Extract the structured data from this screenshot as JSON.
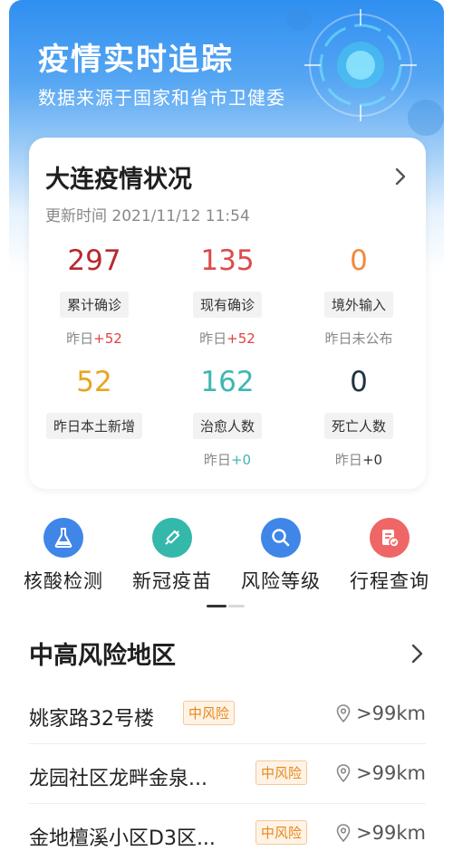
{
  "header": {
    "title": "疫情实时追踪",
    "subtitle": "数据来源于国家和省市卫健委"
  },
  "summary": {
    "title": "大连疫情状况",
    "update_label": "更新时间",
    "update_time": "2021/11/12 11:54",
    "stats": [
      {
        "value": "297",
        "label": "累计确诊",
        "delta_prefix": "昨日",
        "delta": "+52",
        "value_color": "#b8292d"
      },
      {
        "value": "135",
        "label": "现有确诊",
        "delta_prefix": "昨日",
        "delta": "+52",
        "value_color": "#de4a4a"
      },
      {
        "value": "0",
        "label": "境外输入",
        "delta_prefix": "昨日未公布",
        "delta": "",
        "value_color": "#f08a3c"
      },
      {
        "value": "52",
        "label": "昨日本土新增",
        "delta_prefix": "",
        "delta": "",
        "value_color": "#e8a51e"
      },
      {
        "value": "162",
        "label": "治愈人数",
        "delta_prefix": "昨日",
        "delta": "+0",
        "value_color": "#3eb7b1"
      },
      {
        "value": "0",
        "label": "死亡人数",
        "delta_prefix": "昨日",
        "delta": "+0",
        "value_color": "#1f3340"
      }
    ]
  },
  "quick_actions": [
    {
      "label": "核酸检测",
      "icon": "flask-icon",
      "color": "#3f86e8"
    },
    {
      "label": "新冠疫苗",
      "icon": "syringe-icon",
      "color": "#34b8aa"
    },
    {
      "label": "风险等级",
      "icon": "search-icon",
      "color": "#3f86e8"
    },
    {
      "label": "行程查询",
      "icon": "itinerary-icon",
      "color": "#ef6666"
    }
  ],
  "risk_areas": {
    "title": "中高风险地区",
    "items": [
      {
        "name": "姚家路32号楼",
        "level": "中风险",
        "distance": ">99km"
      },
      {
        "name": "龙园社区龙畔金泉...",
        "level": "中风险",
        "distance": ">99km"
      },
      {
        "name": "金地檀溪小区D3区...",
        "level": "中风险",
        "distance": ">99km"
      }
    ]
  },
  "colors": {
    "accent_blue": "#2f8ff0",
    "badge_orange": "#e8861a"
  }
}
